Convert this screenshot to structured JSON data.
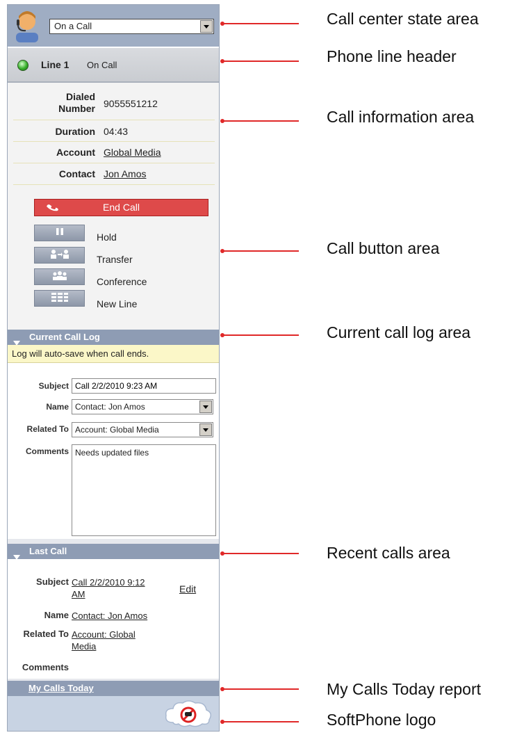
{
  "state": {
    "value": "On a Call"
  },
  "line": {
    "name": "Line 1",
    "status": "On Call"
  },
  "call_info": [
    {
      "label": "Dialed Number",
      "value": "9055551212",
      "link": false
    },
    {
      "label": "Duration",
      "value": "04:43",
      "link": false
    },
    {
      "label": "Account",
      "value": "Global Media",
      "link": true
    },
    {
      "label": "Contact",
      "value": "Jon Amos",
      "link": true
    }
  ],
  "buttons": {
    "end_call": "End Call",
    "hold": "Hold",
    "transfer": "Transfer",
    "conference": "Conference",
    "new_line": "New Line"
  },
  "current_log": {
    "title": "Current Call Log",
    "notice": "Log will auto-save when call ends.",
    "subject_label": "Subject",
    "subject_value": "Call 2/2/2010 9:23 AM",
    "name_label": "Name",
    "name_value": "Contact: Jon Amos",
    "related_label": "Related To",
    "related_value": "Account: Global Media",
    "comments_label": "Comments",
    "comments_value": "Needs updated files"
  },
  "last_call": {
    "title": "Last Call",
    "subject_label": "Subject",
    "subject_line1": "Call 2/2/2010 9:12",
    "subject_line2": "AM",
    "edit": "Edit",
    "name_label": "Name",
    "name_value": "Contact: Jon Amos",
    "related_label": "Related To",
    "related_line1": "Account: Global",
    "related_line2": "Media",
    "comments_label": "Comments"
  },
  "my_calls_today": "My Calls Today",
  "callouts": {
    "state": "Call center state area",
    "line_header": "Phone line header",
    "call_info": "Call information area",
    "call_buttons": "Call button area",
    "current_log": "Current call log area",
    "recent": "Recent calls area",
    "report": "My Calls Today report",
    "logo": "SoftPhone logo"
  },
  "colors": {
    "accent_red": "#e02828",
    "section_header": "#8e9cb4",
    "end_call": "#de4a4a",
    "notice_bg": "#fbf7c8"
  },
  "icons": [
    "agent-avatar-icon",
    "dropdown-arrow-icon",
    "line-status-led-icon",
    "hangup-icon",
    "pause-icon",
    "transfer-icon",
    "conference-icon",
    "new-line-icon",
    "collapse-triangle-icon",
    "softphone-logo-icon"
  ]
}
